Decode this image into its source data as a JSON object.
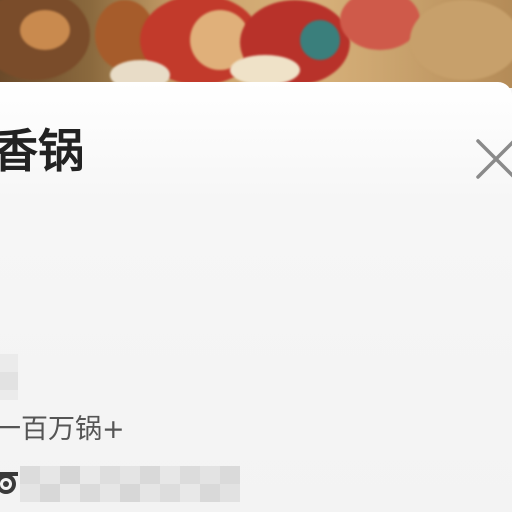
{
  "banner": {
    "description_icon": "new-year-illustration"
  },
  "sheet": {
    "title": "香锅",
    "tagline": "一百万锅+",
    "close_icon": "close-icon",
    "owner_icon": "headset-icon"
  },
  "colors": {
    "title": "#222222",
    "tagline": "#555555",
    "close": "#8a8a8a",
    "sheet_bg": "#f4f4f4"
  }
}
